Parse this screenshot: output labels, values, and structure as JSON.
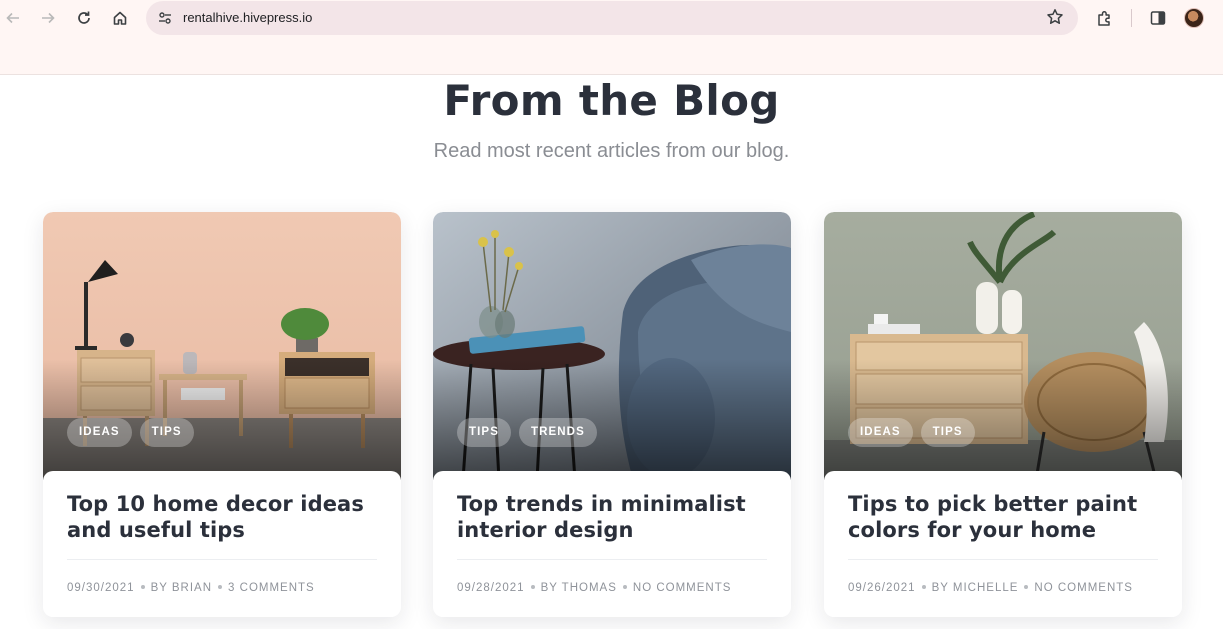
{
  "browser": {
    "url": "rentalhive.hivepress.io"
  },
  "section": {
    "title": "From the Blog",
    "subtitle": "Read most recent articles from our blog."
  },
  "posts": [
    {
      "title": "Top 10 home decor ideas and useful tips",
      "tags": [
        "IDEAS",
        "TIPS"
      ],
      "date": "09/30/2021",
      "author": "BY BRIAN",
      "comments": "3 COMMENTS"
    },
    {
      "title": "Top trends in minimalist interior design",
      "tags": [
        "TIPS",
        "TRENDS"
      ],
      "date": "09/28/2021",
      "author": "BY THOMAS",
      "comments": "NO COMMENTS"
    },
    {
      "title": "Tips to pick better paint colors for your home",
      "tags": [
        "IDEAS",
        "TIPS"
      ],
      "date": "09/26/2021",
      "author": "BY MICHELLE",
      "comments": "NO COMMENTS"
    }
  ],
  "colors": {
    "heading": "#2b303b",
    "subtitle": "#8a8d93",
    "meta": "#8f939a",
    "chrome_bg": "#fff6f4"
  }
}
